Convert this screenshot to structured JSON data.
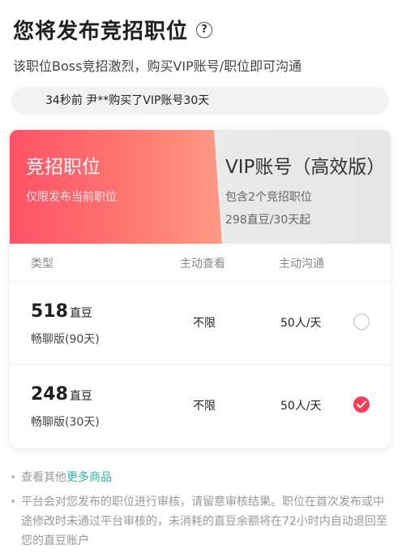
{
  "header": {
    "title": "您将发布竞招职位",
    "help_symbol": "?",
    "subtitle": "该职位Boss竞招激烈，购买VIP账号/职位即可沟通"
  },
  "ticker": {
    "text": "34秒前 尹**购买了VIP账号30天"
  },
  "tabs": {
    "jingzhao": {
      "title": "竞招职位",
      "desc": "仅限发布当前职位"
    },
    "vip": {
      "title": "VIP账号（高效版）",
      "desc1": "包含2个竞招职位",
      "desc2": "298直豆/30天起"
    }
  },
  "table": {
    "headers": {
      "type": "类型",
      "view": "主动查看",
      "chat": "主动沟通"
    },
    "rows": [
      {
        "price": "518",
        "unit": "直豆",
        "name": "畅聊版(90天)",
        "view": "不限",
        "chat": "50人/天",
        "selected": false
      },
      {
        "price": "248",
        "unit": "直豆",
        "name": "畅聊版(30天)",
        "view": "不限",
        "chat": "50人/天",
        "selected": true
      }
    ]
  },
  "notes": {
    "more_prefix": "查看其他",
    "more_link": "更多商品",
    "review": "平台会对您发布的职位进行审核，请留意审核结果。职位在首次发布或中途修改时未通过平台审核的，未消耗的直豆余额将在72小时内自动退回至您的直豆账户"
  },
  "colors": {
    "accent": "#f53d55",
    "link": "#2bb5a8"
  }
}
